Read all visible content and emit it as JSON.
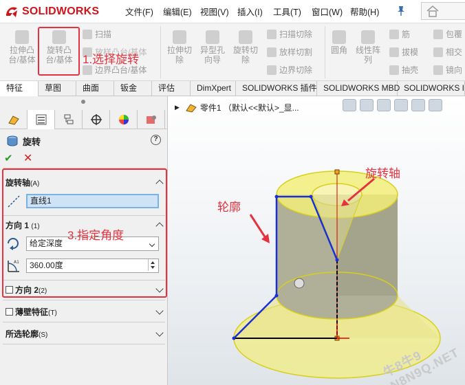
{
  "app": {
    "logo_prefix": "3S",
    "logo_text": "SOLIDWORKS"
  },
  "menu": [
    "文件(F)",
    "编辑(E)",
    "视图(V)",
    "插入(I)",
    "工具(T)",
    "窗口(W)",
    "帮助(H)"
  ],
  "ribbon": {
    "extrude_boss": "拉伸凸\n台/基体",
    "revolve_boss": "旋转凸\n台/基体",
    "sweep": "扫描",
    "loft": "放样凸台/基体",
    "boundary_boss": "边界凸台/基体",
    "extrude_cut": "拉伸切\n除",
    "hole_wizard": "异型孔\n向导",
    "revolve_cut": "旋转切\n除",
    "swept_cut": "扫描切除",
    "lofted_cut": "放样切割",
    "boundary_cut": "边界切除",
    "fillet": "圆角",
    "linear_pattern": "线性阵\n列",
    "rib": "筋",
    "draft": "拔模",
    "shell": "抽壳",
    "wrap": "包覆",
    "intersect": "相交",
    "mirror": "镜向"
  },
  "annotations": {
    "step1": "1.选择旋转",
    "step3": "3.指定角度",
    "axis": "旋转轴",
    "profile": "轮廓"
  },
  "tabs": [
    "特征",
    "草图",
    "曲面",
    "钣金",
    "评估",
    "DimXpert",
    "SOLIDWORKS 插件",
    "SOLIDWORKS MBD",
    "SOLIDWORKS Ins"
  ],
  "property_manager": {
    "title": "旋转",
    "help": "?",
    "axis_section": {
      "title": "旋转轴",
      "suffix": "(A)",
      "value": "直线1"
    },
    "direction1": {
      "title": "方向 1",
      "suffix": "(1)",
      "type": "给定深度",
      "angle": "360.00度"
    },
    "direction2": {
      "title": "方向 2",
      "suffix": "(2)"
    },
    "thin": {
      "title": "薄壁特征",
      "suffix": "(T)"
    },
    "selected": {
      "title": "所选轮廓",
      "suffix": "(S)"
    }
  },
  "viewport": {
    "breadcrumb": "零件1 （默认<<默认>_显..."
  },
  "watermark": "牛8牛9 N8N9Q.NET",
  "colors": {
    "accent_red": "#e5323e",
    "sketch_blue": "#1a2fd6",
    "preview_yellow": "#f2ee7a"
  }
}
